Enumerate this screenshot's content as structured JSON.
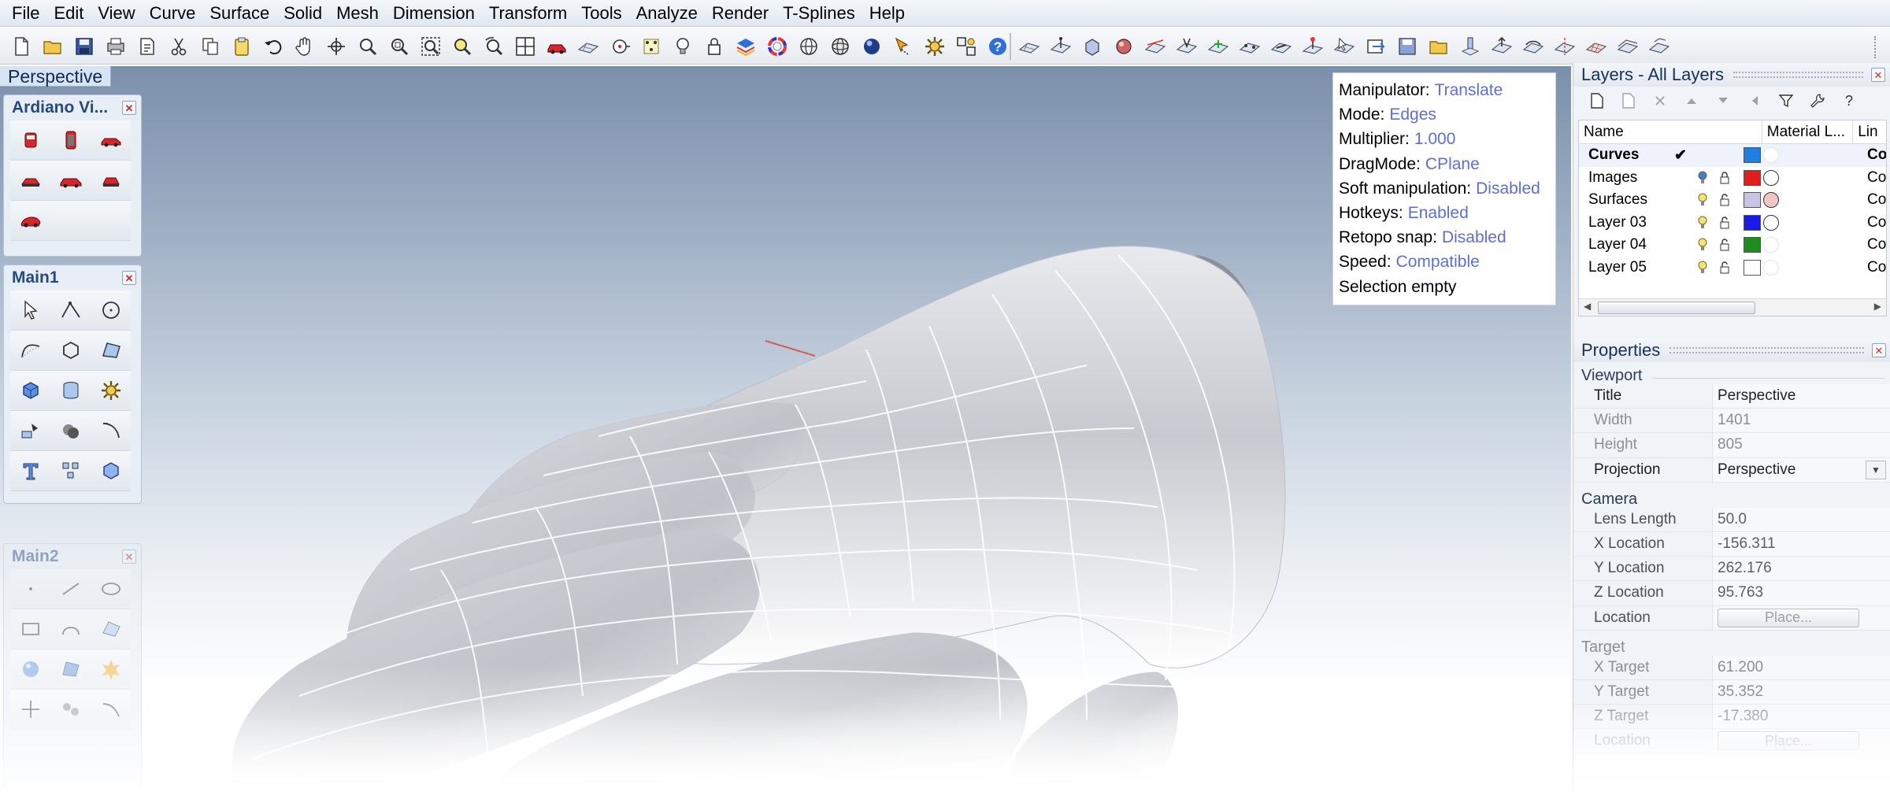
{
  "menu": [
    "File",
    "Edit",
    "View",
    "Curve",
    "Surface",
    "Solid",
    "Mesh",
    "Dimension",
    "Transform",
    "Tools",
    "Analyze",
    "Render",
    "T-Splines",
    "Help"
  ],
  "viewport": {
    "tab_label": "Perspective"
  },
  "toolbars": {
    "ardiano": {
      "title": "Ardiano Vi...",
      "icons": [
        "car-front-icon",
        "car-back-icon",
        "car-side-icon",
        "car-top-icon",
        "car-left-icon",
        "car-right-icon",
        "car-perspective-icon"
      ]
    },
    "main1": {
      "title": "Main1",
      "icons": [
        "select-arrow-icon",
        "polyline-icon",
        "circle-icon",
        "curve-icon",
        "polygon-icon",
        "surface-corner-icon",
        "box-icon",
        "cylinder-icon",
        "gear-icon",
        "extrude-icon",
        "boolean-icon",
        "fillet-icon",
        "text-icon",
        "array-icon",
        "solid-icon"
      ]
    },
    "main2": {
      "title": "Main2"
    }
  },
  "info": {
    "rows": [
      {
        "key": "Manipulator:",
        "value": "Translate"
      },
      {
        "key": "Mode:",
        "value": "Edges"
      },
      {
        "key": "Multiplier:",
        "value": "1.000"
      },
      {
        "key": "DragMode:",
        "value": "CPlane"
      },
      {
        "key": "Soft manipulation:",
        "value": "Disabled"
      },
      {
        "key": "Hotkeys:",
        "value": "Enabled"
      },
      {
        "key": "Retopo snap:",
        "value": "Disabled"
      },
      {
        "key": "Speed:",
        "value": "Compatible"
      },
      {
        "key": "Selection empty",
        "value": ""
      }
    ]
  },
  "layers": {
    "title": "Layers - All Layers",
    "headers": {
      "name": "Name",
      "material": "Material L...",
      "linetype": "Lin"
    },
    "rows": [
      {
        "name": "Curves",
        "current": true,
        "check": "✔",
        "color": "#1f7fe0",
        "material": "blank",
        "linetype": "Co"
      },
      {
        "name": "Images",
        "current": false,
        "check": "",
        "color": "#e51c1c",
        "material": "circle",
        "linetype": "Co"
      },
      {
        "name": "Surfaces",
        "current": false,
        "check": "",
        "color": "#c9c4e6",
        "material": "pink",
        "linetype": "Co"
      },
      {
        "name": "Layer 03",
        "current": false,
        "check": "",
        "color": "#1a1ae6",
        "material": "circle",
        "linetype": "Co"
      },
      {
        "name": "Layer 04",
        "current": false,
        "check": "",
        "color": "#1e8c1e",
        "material": "blank",
        "linetype": "Co"
      },
      {
        "name": "Layer 05",
        "current": false,
        "check": "",
        "color": "#ffffff",
        "material": "blank",
        "linetype": "Co"
      }
    ]
  },
  "properties": {
    "title": "Properties",
    "viewport_section": "Viewport",
    "camera_section": "Camera",
    "target_section": "Target",
    "viewport_rows": [
      {
        "label": "Title",
        "value": "Perspective",
        "readonly": false
      },
      {
        "label": "Width",
        "value": "1401",
        "readonly": true
      },
      {
        "label": "Height",
        "value": "805",
        "readonly": true
      },
      {
        "label": "Projection",
        "value": "Perspective",
        "readonly": false
      }
    ],
    "camera_rows": [
      {
        "label": "Lens Length",
        "value": "50.0"
      },
      {
        "label": "X Location",
        "value": "-156.311"
      },
      {
        "label": "Y Location",
        "value": "262.176"
      },
      {
        "label": "Z Location",
        "value": "95.763"
      },
      {
        "label": "Location",
        "value": "Place..."
      }
    ],
    "target_rows": [
      {
        "label": "X Target",
        "value": "61.200"
      },
      {
        "label": "Y Target",
        "value": "35.352"
      },
      {
        "label": "Z Target",
        "value": "-17.380"
      },
      {
        "label": "Location",
        "value": "Place..."
      }
    ]
  }
}
